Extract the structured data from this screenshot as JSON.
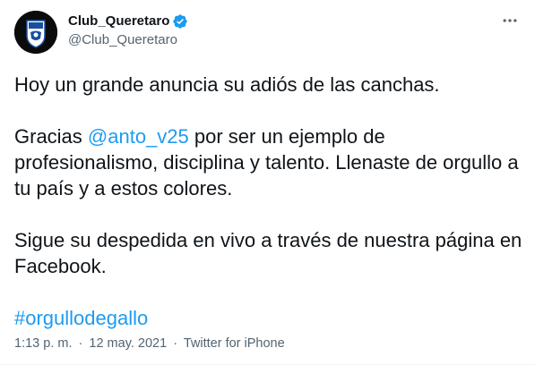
{
  "header": {
    "display_name": "Club_Queretaro",
    "handle": "@Club_Queretaro",
    "verified_icon": "verified-badge-icon",
    "more_icon": "more-options-icon",
    "verified_color": "#1d9bf0"
  },
  "tweet": {
    "line1": "Hoy un grande anuncia su adiós de las canchas.",
    "p2_pre": "Gracias ",
    "mention": "@anto_v25",
    "p2_post": " por ser un ejemplo de profesionalismo, disciplina y talento. Llenaste de orgullo a tu país y a estos colores.",
    "p3": "Sigue su despedida en vivo a través de nuestra página en Facebook.",
    "hashtag": "#orgullodegallo",
    "link_color": "#1d9bf0"
  },
  "meta": {
    "time": "1:13 p. m.",
    "separator": "·",
    "date": "12 may. 2021",
    "source": "Twitter for iPhone"
  }
}
